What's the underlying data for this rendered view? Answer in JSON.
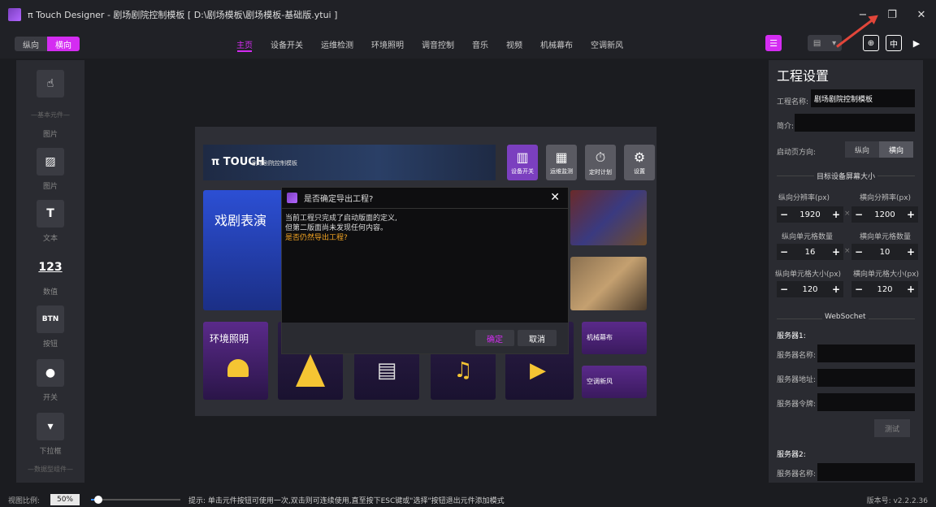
{
  "window": {
    "title": "π Touch Designer - 剧场剧院控制模板 [ D:\\剧场模板\\剧场模板-基础版.ytui ]",
    "controls": [
      "−",
      "❐",
      "✕"
    ]
  },
  "toolbar": {
    "orientation": [
      "纵向",
      "横向"
    ],
    "orientation_selected": "横向",
    "tabs": [
      "主页",
      "设备开关",
      "运维检测",
      "环境照明",
      "调音控制",
      "音乐",
      "视频",
      "机械幕布",
      "空调新风"
    ],
    "active_tab": "主页"
  },
  "palette": {
    "section_basic": "—基本元件—",
    "section_data": "—数据型组件—",
    "items": [
      {
        "label": "图片",
        "icon": "hand-pointer-icon"
      },
      {
        "label": "图片",
        "icon": "image-icon"
      },
      {
        "label": "文本",
        "icon": "text-icon",
        "glyph": "T"
      },
      {
        "label": "数值",
        "icon": "number-icon",
        "glyph": "123"
      },
      {
        "label": "按钮",
        "icon": "button-icon",
        "glyph": "BTN"
      },
      {
        "label": "开关",
        "icon": "toggle-icon"
      },
      {
        "label": "下拉框",
        "icon": "dropdown-icon"
      }
    ]
  },
  "canvas": {
    "brand": "π TOUCH",
    "brand_sub": "剧场剧院控制模板",
    "top_icons": [
      {
        "label": "设备开关",
        "color": "#7b3fbf"
      },
      {
        "label": "运维监测",
        "color": "#5a5a62"
      },
      {
        "label": "定时计划",
        "color": "#5a5a62"
      },
      {
        "label": "设置",
        "color": "#5a5a62"
      }
    ],
    "drama": "戏剧表演",
    "env_light": "环境照明",
    "curtain": "机械幕布",
    "ac": "空调新风"
  },
  "dialog": {
    "title": "是否确定导出工程?",
    "line1": "当前工程只完成了启动版面的定义,",
    "line2": "但第二版面尚未发现任何内容。",
    "warn": "是否仍然导出工程?",
    "ok": "确定",
    "cancel": "取消"
  },
  "panel": {
    "title": "工程设置",
    "name_label": "工程名称:",
    "name_value": "剧场剧院控制模板",
    "intro_label": "简介:",
    "intro_value": "",
    "start_label": "启动页方向:",
    "start_options": [
      "纵向",
      "横向"
    ],
    "start_selected": "横向",
    "screen_size_title": "目标设备屏幕大小",
    "v_res_label": "纵向分辨率(px)",
    "h_res_label": "横向分辨率(px)",
    "v_res": "1920",
    "h_res": "1200",
    "v_cells_label": "纵向单元格数量",
    "h_cells_label": "横向单元格数量",
    "v_cells": "16",
    "h_cells": "10",
    "v_cell_size_label": "纵向单元格大小(px)",
    "h_cell_size_label": "横向单元格大小(px)",
    "v_cell_size": "120",
    "h_cell_size": "120",
    "times": "×",
    "minus": "−",
    "plus": "+",
    "websocket_title": "WebSochet",
    "server1_title": "服务器1:",
    "server_name_label": "服务器名称:",
    "server_addr_label": "服务器地址:",
    "server_token_label": "服务器令牌:",
    "test_button": "测试",
    "server2_title": "服务器2:"
  },
  "status": {
    "zoom_label": "视图比例:",
    "zoom_value": "50%",
    "zoom_level": 0.08,
    "hint": "提示: 单击元件按钮可使用一次,双击则可连续使用,直至按下ESC键或\"选择\"按钮退出元件添加模式",
    "version": "版本号: v2.2.2.36"
  },
  "colors": {
    "accent": "#d42cf2",
    "warn": "#f5a623",
    "arrow": "#e2463a"
  }
}
